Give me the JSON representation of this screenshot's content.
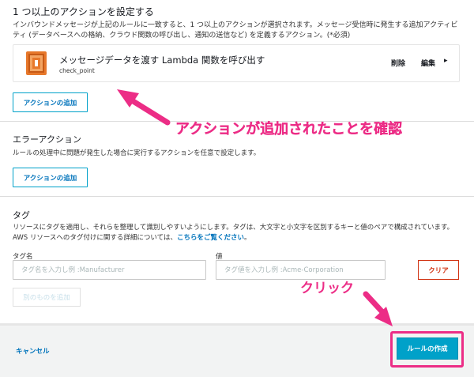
{
  "actions_section": {
    "title": "1 つ以上のアクションを設定する",
    "description": "インバウンドメッセージが上記のルールに一致すると、1 つ以上のアクションが選択されます。メッセージ受信時に発生する追加アクティビティ (データベースへの格納、クラウド関数の呼び出し、通知の送信など) を定義するアクション。(*必須)",
    "card": {
      "icon": "lambda-icon",
      "title": "メッセージデータを渡す Lambda 関数を呼び出す",
      "subtitle": "check_point",
      "delete_label": "削除",
      "edit_label": "編集",
      "chevron": "▸"
    },
    "add_button": "アクションの追加"
  },
  "error_section": {
    "title": "エラーアクション",
    "description": "ルールの処理中に問題が発生した場合に実行するアクションを任意で設定します。",
    "add_button": "アクションの追加"
  },
  "tag_section": {
    "title": "タグ",
    "description_line1": "リソースにタグを適用し、それらを整理して識別しやすいようにします。タグは、大文字と小文字を区別するキーと値のペアで構成されています。",
    "description_line2_prefix": "AWS リソースへのタグ付けに関する詳細については、",
    "link_text": "こちらをご覧ください",
    "description_line2_suffix": "。",
    "name_label": "タグ名",
    "name_placeholder": "タグ名を入力し例 :Manufacturer",
    "value_label": "値",
    "value_placeholder": "タグ値を入力し例 :Acme-Corporation",
    "clear_button": "クリア",
    "add_other_button": "別のものを追加"
  },
  "footer": {
    "cancel": "キャンセル",
    "create_button": "ルールの作成"
  },
  "annotations": {
    "confirm_text": "アクションが追加されたことを確認",
    "click_text": "クリック",
    "color": "#ec2d86"
  },
  "colors": {
    "primary": "#00a1c9",
    "link": "#0073bb",
    "danger": "#d13212",
    "lambda_orange": "#e7782b"
  }
}
